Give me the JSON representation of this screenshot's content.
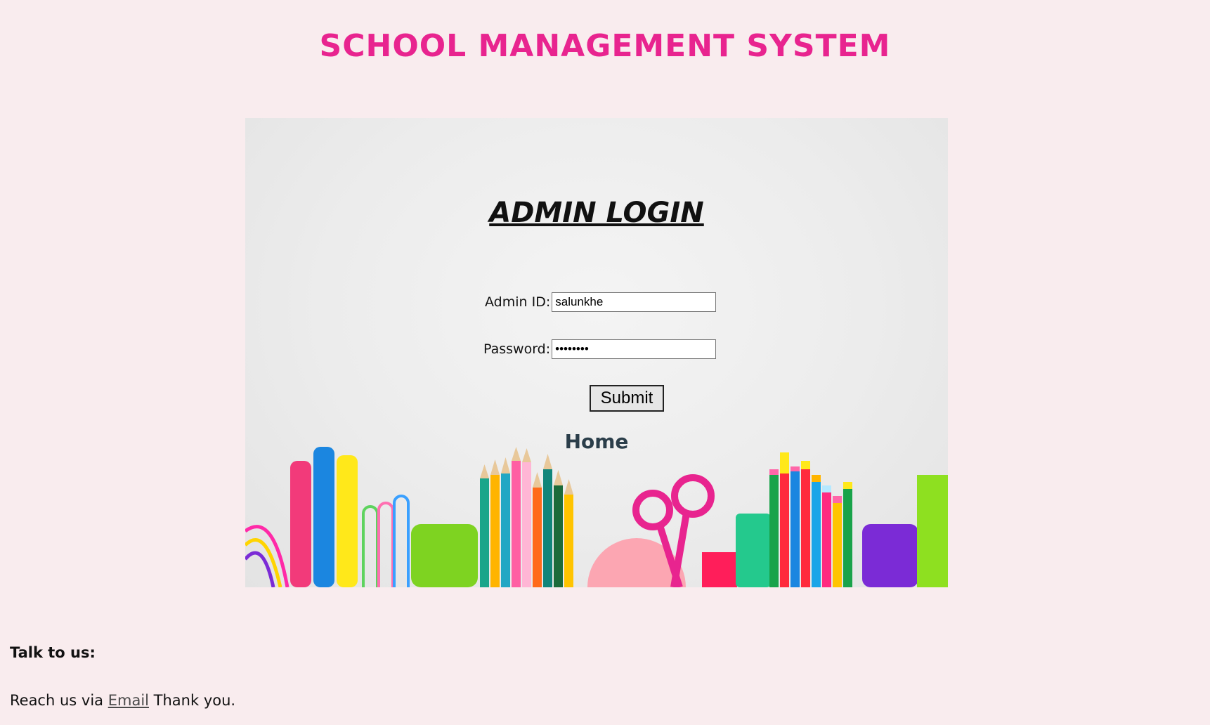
{
  "header": {
    "title": "SCHOOL MANAGEMENT SYSTEM"
  },
  "login": {
    "heading": "ADMIN LOGIN",
    "admin_id_label": "Admin ID:",
    "admin_id_value": "salunkhe",
    "password_label": "Password:",
    "password_value": "salunkhe",
    "submit_label": "Submit",
    "home_link": "Home"
  },
  "footer": {
    "heading": "Talk to us:",
    "text_before": "Reach us via",
    "email_link": "Email",
    "text_after": "Thank you."
  },
  "colors": {
    "title": "#e8248f",
    "page_background": "#f9ecee",
    "home_link": "#2b3e4a"
  },
  "icons": [
    "school-supplies-illustration"
  ]
}
